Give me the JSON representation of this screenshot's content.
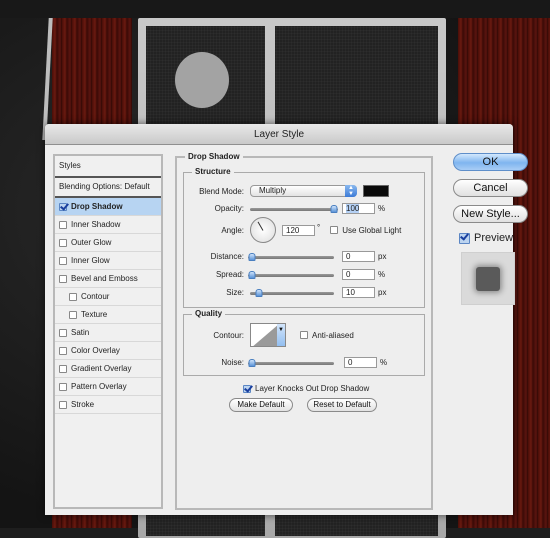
{
  "dialog": {
    "title": "Layer Style"
  },
  "styles_list": {
    "header": "Styles",
    "blending_options": "Blending Options: Default",
    "items": [
      {
        "label": "Drop Shadow",
        "checked": true,
        "selected": true,
        "indent": false
      },
      {
        "label": "Inner Shadow",
        "checked": false,
        "selected": false,
        "indent": false
      },
      {
        "label": "Outer Glow",
        "checked": false,
        "selected": false,
        "indent": false
      },
      {
        "label": "Inner Glow",
        "checked": false,
        "selected": false,
        "indent": false
      },
      {
        "label": "Bevel and Emboss",
        "checked": false,
        "selected": false,
        "indent": false
      },
      {
        "label": "Contour",
        "checked": false,
        "selected": false,
        "indent": true
      },
      {
        "label": "Texture",
        "checked": false,
        "selected": false,
        "indent": true
      },
      {
        "label": "Satin",
        "checked": false,
        "selected": false,
        "indent": false
      },
      {
        "label": "Color Overlay",
        "checked": false,
        "selected": false,
        "indent": false
      },
      {
        "label": "Gradient Overlay",
        "checked": false,
        "selected": false,
        "indent": false
      },
      {
        "label": "Pattern Overlay",
        "checked": false,
        "selected": false,
        "indent": false
      },
      {
        "label": "Stroke",
        "checked": false,
        "selected": false,
        "indent": false
      }
    ]
  },
  "drop_shadow": {
    "section_title": "Drop Shadow",
    "structure": {
      "title": "Structure",
      "blend_mode_label": "Blend Mode:",
      "blend_mode_value": "Multiply",
      "shadow_color": "#0a0a0a",
      "opacity_label": "Opacity:",
      "opacity_value": "100",
      "opacity_unit": "%",
      "opacity_fraction": 1.0,
      "angle_label": "Angle:",
      "angle_value": "120",
      "angle_unit": "°",
      "use_global_light_label": "Use Global Light",
      "use_global_light_checked": false,
      "distance_label": "Distance:",
      "distance_value": "0",
      "distance_unit": "px",
      "distance_fraction": 0.0,
      "spread_label": "Spread:",
      "spread_value": "0",
      "spread_unit": "%",
      "spread_fraction": 0.0,
      "size_label": "Size:",
      "size_value": "10",
      "size_unit": "px",
      "size_fraction": 0.07
    },
    "quality": {
      "title": "Quality",
      "contour_label": "Contour:",
      "anti_aliased_label": "Anti-aliased",
      "anti_aliased_checked": false,
      "noise_label": "Noise:",
      "noise_value": "0",
      "noise_unit": "%",
      "noise_fraction": 0.0
    },
    "layer_knocks_out_label": "Layer Knocks Out Drop Shadow",
    "layer_knocks_out_checked": true,
    "make_default_label": "Make Default",
    "reset_default_label": "Reset to Default"
  },
  "buttons": {
    "ok": "OK",
    "cancel": "Cancel",
    "new_style": "New Style..."
  },
  "preview": {
    "label": "Preview",
    "checked": true
  }
}
